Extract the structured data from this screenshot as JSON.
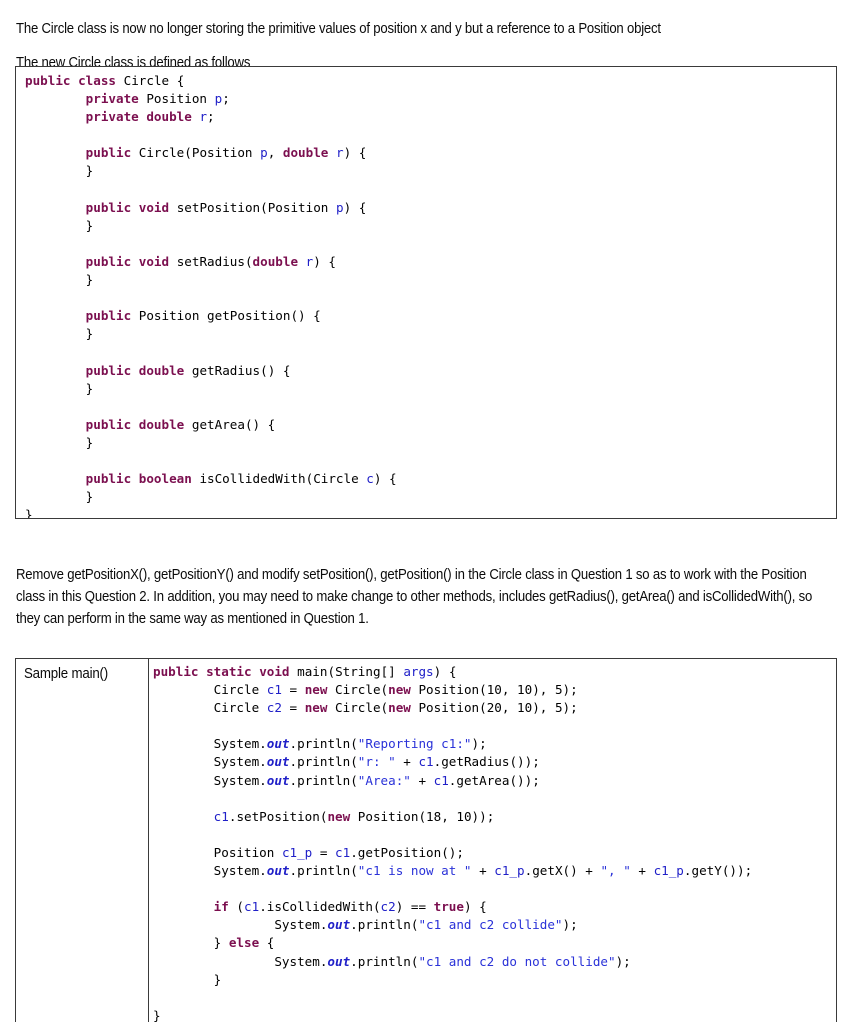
{
  "document": {
    "intro_paragraph_1": "The Circle class is now no longer storing the primitive values of position x and y but a reference to a Position object",
    "intro_paragraph_2": "The new Circle class is defined as follows",
    "middle_paragraph": "Remove getPositionX(), getPositionY() and modify setPosition(), getPosition() in the Circle class in Question 1 so as to work with the Position class in this Question 2. In addition, you may need to make change to other methods, includes getRadius(), getArea() and isCollidedWith(), so they can perform in the same way as mentioned in Question 1."
  },
  "class_code_box": {
    "language": "java",
    "lines": [
      "public class Circle {",
      "        private Position p;",
      "        private double r;",
      "",
      "        public Circle(Position p, double r) {",
      "        }",
      "",
      "        public void setPosition(Position p) {",
      "        }",
      "",
      "        public void setRadius(double r) {",
      "        }",
      "",
      "        public Position getPosition() {",
      "        }",
      "",
      "        public double getRadius() {",
      "        }",
      "",
      "        public double getArea() {",
      "        }",
      "",
      "        public boolean isCollidedWith(Circle c) {",
      "        }",
      "}"
    ]
  },
  "main_table": {
    "row_label": "Sample main()",
    "code_lines": [
      "public static void main(String[] args) {",
      "        Circle c1 = new Circle(new Position(10, 10), 5);",
      "        Circle c2 = new Circle(new Position(20, 10), 5);",
      "",
      "        System.out.println(\"Reporting c1:\");",
      "        System.out.println(\"r: \" + c1.getRadius());",
      "        System.out.println(\"Area:\" + c1.getArea());",
      "",
      "        c1.setPosition(new Position(18, 10));",
      "",
      "        Position c1_p = c1.getPosition();",
      "        System.out.println(\"c1 is now at \" + c1_p.getX() + \", \" + c1_p.getY());",
      "",
      "        if (c1.isCollidedWith(c2) == true) {",
      "                System.out.println(\"c1 and c2 collide\");",
      "        } else {",
      "                System.out.println(\"c1 and c2 do not collide\");",
      "        }",
      "",
      "}"
    ]
  },
  "colors": {
    "keyword": "#7b0f4f",
    "variable": "#2020c8",
    "string": "#2a32d8",
    "field": "#2020c8",
    "plain": "#000000",
    "border": "#3a3a3a",
    "background": "#ffffff",
    "text": "#0b0b0b"
  }
}
